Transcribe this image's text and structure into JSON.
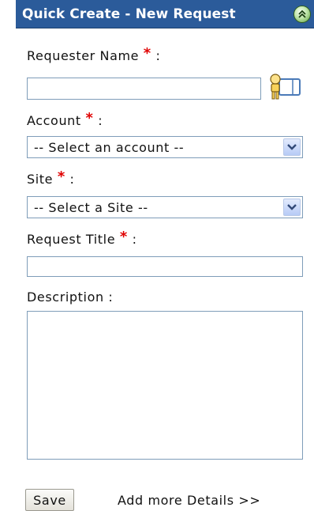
{
  "header": {
    "title": "Quick Create - New Request",
    "collapse_icon": "collapse-up-icon"
  },
  "form": {
    "requester": {
      "label": "Requester Name",
      "required_mark": "*",
      "separator": ":",
      "value": "",
      "lookup_icon": "contact-lookup-icon"
    },
    "account": {
      "label": "Account",
      "required_mark": "*",
      "separator": ":",
      "selected": "-- Select an account --"
    },
    "site": {
      "label": "Site",
      "required_mark": "*",
      "separator": ":",
      "selected": "-- Select a Site --"
    },
    "request_title": {
      "label": "Request Title",
      "required_mark": "*",
      "separator": ":",
      "value": ""
    },
    "description": {
      "label": "Description :",
      "value": ""
    }
  },
  "actions": {
    "save_label": "Save",
    "more_details_label": "Add more Details >>"
  },
  "colors": {
    "header_bg": "#2b5b9a",
    "required": "#e00000",
    "field_border": "#7f9db9"
  }
}
